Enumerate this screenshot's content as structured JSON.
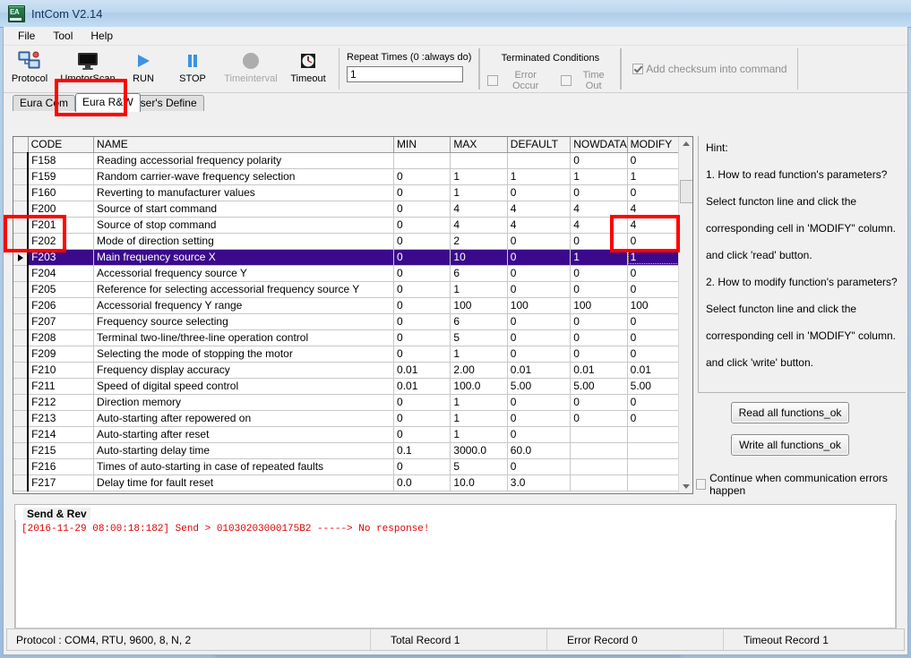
{
  "window": {
    "title": "IntCom V2.14",
    "app_icon": "eura-logo-icon"
  },
  "menu": {
    "items": [
      "File",
      "Tool",
      "Help"
    ]
  },
  "toolbar": {
    "buttons": [
      {
        "label": "Protocol",
        "icon": "network-protocol-icon",
        "enabled": true
      },
      {
        "label": "UmotorScan",
        "icon": "monitor-icon",
        "enabled": true
      },
      {
        "label": "RUN",
        "icon": "play-icon",
        "enabled": true
      },
      {
        "label": "STOP",
        "icon": "pause-icon",
        "enabled": true
      },
      {
        "label": "Timeinterval",
        "icon": "circle-icon",
        "enabled": false
      },
      {
        "label": "Timeout",
        "icon": "clock-icon",
        "enabled": true
      }
    ],
    "repeat_group": {
      "title": "Repeat Times (0 :always do)",
      "value": "1"
    },
    "terminated_group": {
      "title": "Terminated Conditions",
      "error_occur_label": "Error Occur",
      "error_occur_checked": false,
      "time_out_label": "Time Out",
      "time_out_checked": false
    },
    "checksum_group": {
      "label": "Add checksum into command",
      "checked": true,
      "disabled": true
    }
  },
  "tabs": [
    {
      "label": "Eura Com",
      "active": false
    },
    {
      "label": "Eura R&W",
      "active": true
    },
    {
      "label": "User's Define",
      "active": false
    }
  ],
  "grid": {
    "columns": [
      "CODE",
      "NAME",
      "MIN",
      "MAX",
      "DEFAULT",
      "NOWDATA",
      "MODIFY"
    ],
    "selected_row_index": 6,
    "selected_cell_column": "MODIFY",
    "rows": [
      {
        "code": "F158",
        "name": "Reading accessorial frequency polarity",
        "min": "",
        "max": "",
        "default": "",
        "nowdata": "0",
        "modify": "0"
      },
      {
        "code": "F159",
        "name": "Random carrier-wave frequency selection",
        "min": "0",
        "max": "1",
        "default": "1",
        "nowdata": "1",
        "modify": "1"
      },
      {
        "code": "F160",
        "name": "Reverting to manufacturer values",
        "min": "0",
        "max": "1",
        "default": "0",
        "nowdata": "0",
        "modify": "0"
      },
      {
        "code": "F200",
        "name": "Source of start command",
        "min": "0",
        "max": "4",
        "default": "4",
        "nowdata": "4",
        "modify": "4"
      },
      {
        "code": "F201",
        "name": "Source of stop command",
        "min": "0",
        "max": "4",
        "default": "4",
        "nowdata": "4",
        "modify": "4"
      },
      {
        "code": "F202",
        "name": "Mode of direction setting",
        "min": "0",
        "max": "2",
        "default": "0",
        "nowdata": "0",
        "modify": "0"
      },
      {
        "code": "F203",
        "name": "Main frequency source X",
        "min": "0",
        "max": "10",
        "default": "0",
        "nowdata": "1",
        "modify": "1"
      },
      {
        "code": "F204",
        "name": "Accessorial frequency source Y",
        "min": "0",
        "max": "6",
        "default": "0",
        "nowdata": "0",
        "modify": "0"
      },
      {
        "code": "F205",
        "name": "Reference for selecting  accessorial frequency source Y",
        "min": "0",
        "max": "1",
        "default": "0",
        "nowdata": "0",
        "modify": "0"
      },
      {
        "code": "F206",
        "name": "Accessorial frequency Y range",
        "min": "0",
        "max": "100",
        "default": "100",
        "nowdata": "100",
        "modify": "100"
      },
      {
        "code": "F207",
        "name": "Frequency source selecting",
        "min": "0",
        "max": "6",
        "default": "0",
        "nowdata": "0",
        "modify": "0"
      },
      {
        "code": "F208",
        "name": "Terminal two-line/three-line operation control",
        "min": "0",
        "max": "5",
        "default": "0",
        "nowdata": "0",
        "modify": "0"
      },
      {
        "code": "F209",
        "name": "Selecting the mode of stopping the motor",
        "min": "0",
        "max": "1",
        "default": "0",
        "nowdata": "0",
        "modify": "0"
      },
      {
        "code": "F210",
        "name": "Frequency display accuracy",
        "min": "0.01",
        "max": "2.00",
        "default": "0.01",
        "nowdata": "0.01",
        "modify": "0.01"
      },
      {
        "code": "F211",
        "name": "Speed of digital speed control",
        "min": "0.01",
        "max": "100.0",
        "default": "5.00",
        "nowdata": "5.00",
        "modify": "5.00"
      },
      {
        "code": "F212",
        "name": "Direction memory",
        "min": "0",
        "max": "1",
        "default": "0",
        "nowdata": "0",
        "modify": "0"
      },
      {
        "code": "F213",
        "name": "Auto-starting after repowered on",
        "min": "0",
        "max": "1",
        "default": "0",
        "nowdata": "0",
        "modify": "0"
      },
      {
        "code": "F214",
        "name": "Auto-starting  after reset",
        "min": "0",
        "max": "1",
        "default": "0",
        "nowdata": "",
        "modify": ""
      },
      {
        "code": "F215",
        "name": "Auto-starting delay time",
        "min": "0.1",
        "max": "3000.0",
        "default": "60.0",
        "nowdata": "",
        "modify": ""
      },
      {
        "code": "F216",
        "name": "Times of auto-starting in case of repeated faults",
        "min": "0",
        "max": "5",
        "default": "0",
        "nowdata": "",
        "modify": ""
      },
      {
        "code": "F217",
        "name": "Delay time for fault reset",
        "min": "0.0",
        "max": "10.0",
        "default": "3.0",
        "nowdata": "",
        "modify": ""
      }
    ]
  },
  "hint": {
    "lines": [
      "Hint:",
      "1. How to read function's parameters?",
      "Select functon line and click the",
      "corresponding cell in  'MODIFY\" column.",
      "and click 'read' button.",
      "2. How to modify function's parameters?",
      "Select functon line and click the",
      "corresponding cell in  'MODIFY\" column.",
      "and click 'write' button."
    ],
    "read_button": "Read all functions_ok",
    "write_button": "Write all functions_ok",
    "continue_checkbox": "Continue when communication errors happen",
    "continue_checked": false
  },
  "send_rev": {
    "title": "Send & Rev",
    "log": "[2016-11-29 08:00:18:182] Send  >   01030203000175B2  -----> No response!"
  },
  "status_bar": {
    "protocol": "Protocol :  COM4, RTU, 9600, 8, N, 2",
    "total_record": "Total Record  1",
    "error_record": "Error Record  0",
    "timeout_record": "Timeout Record  1"
  },
  "annotations": {
    "color": "#ff0000",
    "boxes": [
      "tab-eura-rw",
      "row-f203-code",
      "cell-f203-modify"
    ]
  }
}
